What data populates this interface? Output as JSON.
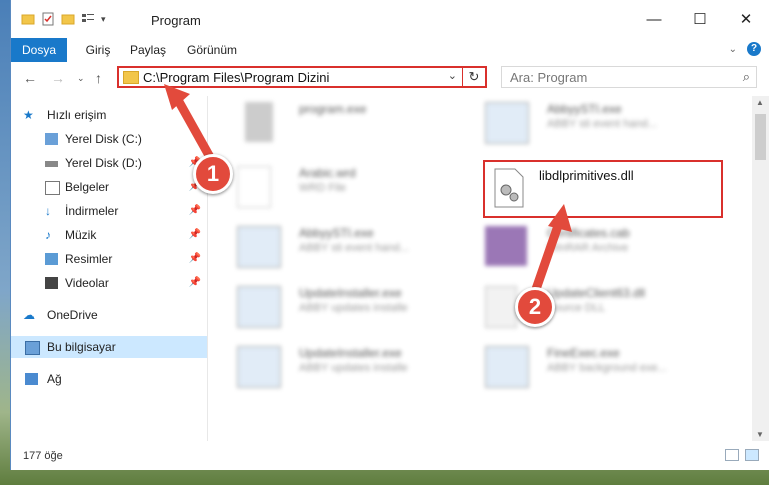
{
  "window": {
    "title": "Program"
  },
  "ribbon": {
    "tabs": [
      "Dosya",
      "Giriş",
      "Paylaş",
      "Görünüm"
    ]
  },
  "navigation": {
    "address": "C:\\Program Files\\Program Dizini",
    "search_placeholder": "Ara: Program"
  },
  "sidebar": {
    "items": [
      {
        "label": "Hızlı erişim"
      },
      {
        "label": "Yerel Disk (C:)"
      },
      {
        "label": "Yerel Disk (D:)"
      },
      {
        "label": "Belgeler"
      },
      {
        "label": "İndirmeler"
      },
      {
        "label": "Müzik"
      },
      {
        "label": "Resimler"
      },
      {
        "label": "Videolar"
      },
      {
        "label": "OneDrive"
      },
      {
        "label": "Bu bilgisayar"
      },
      {
        "label": "Ağ"
      }
    ]
  },
  "files": [
    {
      "name": "program.exe",
      "desc": ""
    },
    {
      "name": "AbbyySTI.exe",
      "desc": "ABBY sti event hand..."
    },
    {
      "name": "Arabic.wrd",
      "desc": "WRD File"
    },
    {
      "name": "libdlprimitives.dll",
      "desc": ""
    },
    {
      "name": "AbbyySTI.exe",
      "desc": "ABBY sti event hand..."
    },
    {
      "name": "Certificates.cab",
      "desc": "WinRAR Archive"
    },
    {
      "name": "UpdateInstaller.exe",
      "desc": "ABBY updates installe"
    },
    {
      "name": "UpdateClient63.dll",
      "desc": "Source DLL"
    },
    {
      "name": "UpdateInstaller.exe",
      "desc": "ABBY updates installe"
    },
    {
      "name": "FineExec.exe",
      "desc": "ABBY background exe..."
    }
  ],
  "status": {
    "count": "177 öğe"
  },
  "annotations": {
    "step1": "1",
    "step2": "2"
  },
  "colors": {
    "accent": "#1979ca",
    "highlight": "#d9302c",
    "badge": "#e24a3c"
  }
}
